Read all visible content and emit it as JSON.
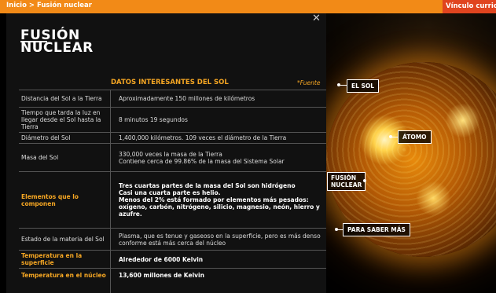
{
  "topbar": {
    "breadcrumb": "Inicio  >  Fusión nuclear",
    "right_link": "Vínculo curricular"
  },
  "panel": {
    "logo_line1": "FUSIÓN",
    "logo_line2": "NUCLEAR",
    "section_title": "DATOS INTERESANTES DEL SOL",
    "source_link": "*Fuente",
    "close": "✕"
  },
  "facts": [
    {
      "key": "Distancia del Sol a la Tierra",
      "value": "Aproximadamente 150 millones de kilómetros",
      "highlight": false
    },
    {
      "key": "Tiempo que tarda la luz en llegar desde el Sol hasta la Tierra",
      "value": "8 minutos 19 segundos",
      "highlight": false
    },
    {
      "key": "Diámetro del Sol",
      "value": "1,400,000 kilómetros. 109 veces el diámetro de la Tierra",
      "highlight": false
    },
    {
      "key": "Masa del Sol",
      "value": "330,000 veces la masa de la Tierra\nContiene cerca de 99.86% de la masa del Sistema Solar",
      "highlight": false
    },
    {
      "key": "Elementos que lo componen",
      "value": "Tres cuartas partes de la masa del Sol son hidrógeno\nCasi una cuarta parte es helio.\nMenos del 2% está formado por elementos más pesados: oxígeno, carbón, nitrógeno, silicio, magnesio, neón, hierro y azufre.",
      "highlight": true
    },
    {
      "key": "Estado de la materia del Sol",
      "value": "Plasma, que es tenue y gaseoso en la superficie, pero es más denso conforme está más cerca del núcleo",
      "highlight": false
    },
    {
      "key": "Temperatura en la superficie",
      "value": "Alrededor de 6000 Kelvin",
      "highlight": true
    },
    {
      "key": "Temperatura en el núcleo",
      "value": "13,600 millones de Kelvin",
      "highlight": true
    }
  ],
  "sun_labels": {
    "el_sol": "EL SOL",
    "atomo": "ÁTOMO",
    "fusion_line1": "FUSIÓN",
    "fusion_line2": "NUCLEAR",
    "para_saber": "PARA SABER MÁS"
  },
  "colors": {
    "accent": "#f28a17",
    "highlight_text": "#f5a623",
    "top_right": "#e0441f"
  }
}
